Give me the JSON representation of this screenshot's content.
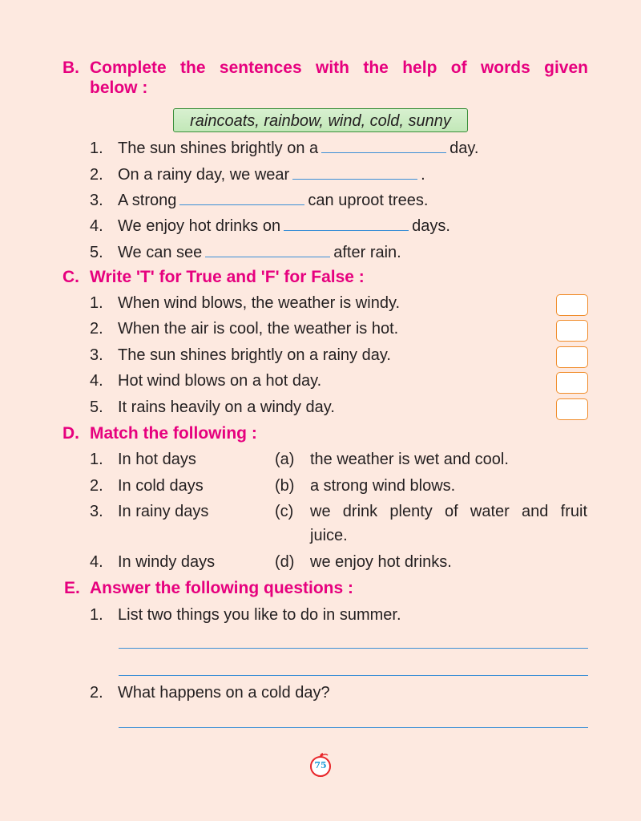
{
  "sectionB": {
    "letter": "B.",
    "heading_line1": "Complete the sentences with the help of words given",
    "heading_line2": "below :",
    "word_box": "raincoats, rainbow, wind, cold, sunny",
    "items": [
      {
        "num": "1.",
        "before": "The sun shines brightly on a",
        "after": "day."
      },
      {
        "num": "2.",
        "before": "On a rainy day, we wear",
        "after": "."
      },
      {
        "num": "3.",
        "before": "A strong",
        "after": "can uproot trees."
      },
      {
        "num": "4.",
        "before": "We enjoy hot drinks on",
        "after": "days."
      },
      {
        "num": "5.",
        "before": "We can see",
        "after": "after rain."
      }
    ]
  },
  "sectionC": {
    "letter": "C.",
    "heading": "Write 'T' for True and 'F' for False :",
    "items": [
      {
        "num": "1.",
        "text": "When wind blows, the weather is windy."
      },
      {
        "num": "2.",
        "text": "When the air is cool, the weather is hot."
      },
      {
        "num": "3.",
        "text": "The sun shines brightly on a rainy day."
      },
      {
        "num": "4.",
        "text": "Hot wind blows on a hot day."
      },
      {
        "num": "5.",
        "text": "It rains heavily on a windy day."
      }
    ]
  },
  "sectionD": {
    "letter": "D.",
    "heading": "Match the following :",
    "items": [
      {
        "num": "1.",
        "left": "In hot days",
        "mark": "(a)",
        "right": "the weather is wet and cool."
      },
      {
        "num": "2.",
        "left": "In cold days",
        "mark": "(b)",
        "right": "a strong wind blows."
      },
      {
        "num": "3.",
        "left": "In rainy days",
        "mark": "(c)",
        "right": "we drink plenty of water and fruit",
        "right_cont": "juice."
      },
      {
        "num": "4.",
        "left": "In windy days",
        "mark": "(d)",
        "right": "we enjoy hot drinks."
      }
    ]
  },
  "sectionE": {
    "letter": "E.",
    "heading": "Answer the following questions :",
    "items": [
      {
        "num": "1.",
        "text": "List two things you like to do in summer."
      },
      {
        "num": "2.",
        "text": "What happens on a cold day?"
      }
    ]
  },
  "page_number": "75",
  "colors": {
    "heading": "#e6007e",
    "answer_line": "#3b8fd6",
    "tf_box_border": "#f08c2a",
    "word_box_border": "#3a8f3a",
    "background": "#fde9e0"
  }
}
